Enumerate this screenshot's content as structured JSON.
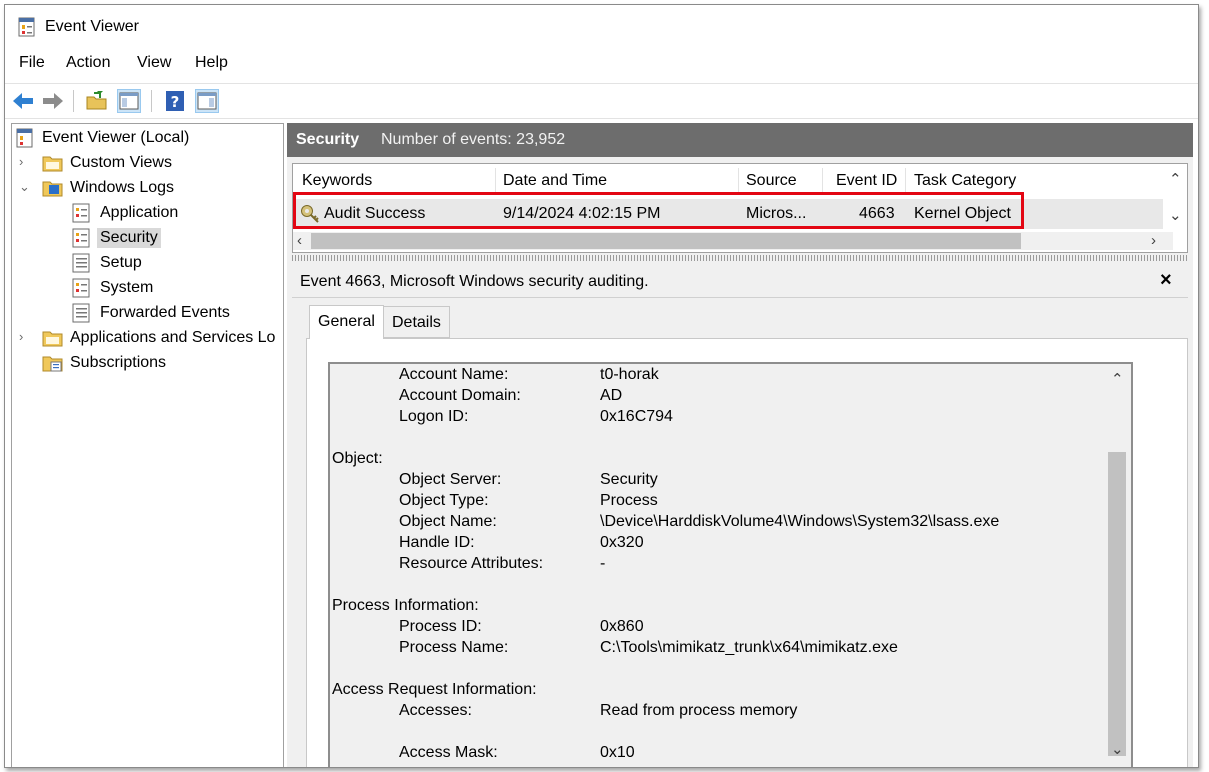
{
  "window": {
    "title": "Event Viewer"
  },
  "menu": [
    "File",
    "Action",
    "View",
    "Help"
  ],
  "toolbar": [
    "back-arrow-icon",
    "forward-arrow-icon",
    "open-folder-icon",
    "show-hide-console-tree-icon",
    "help-icon",
    "show-hide-action-pane-icon"
  ],
  "tree": {
    "root": "Event Viewer (Local)",
    "custom_views": "Custom Views",
    "windows_logs": "Windows Logs",
    "application": "Application",
    "security": "Security",
    "setup": "Setup",
    "system": "System",
    "forwarded_events": "Forwarded Events",
    "apps_services": "Applications and Services Lo",
    "subscriptions": "Subscriptions"
  },
  "log_header": {
    "name": "Security",
    "count_text": "Number of events: 23,952"
  },
  "grid": {
    "columns": [
      "Keywords",
      "Date and Time",
      "Source",
      "Event ID",
      "Task Category"
    ],
    "rows": [
      {
        "keywords": "Audit Success",
        "datetime": "9/14/2024 4:02:15 PM",
        "source": "Micros...",
        "event_id": "4663",
        "task_category": "Kernel Object"
      }
    ]
  },
  "detail": {
    "header": "Event 4663, Microsoft Windows security auditing.",
    "close": "×",
    "tabs": [
      "General",
      "Details"
    ],
    "active_tab": "General",
    "lines": [
      {
        "label": "Account Name:",
        "value": "t0-horak"
      },
      {
        "label": "Account Domain:",
        "value": "AD"
      },
      {
        "label": "Logon ID:",
        "value": "0x16C794"
      },
      {
        "section": "Object:"
      },
      {
        "label": "Object Server:",
        "value": "Security"
      },
      {
        "label": "Object Type:",
        "value": "Process"
      },
      {
        "label": "Object Name:",
        "value": "\\Device\\HarddiskVolume4\\Windows\\System32\\lsass.exe"
      },
      {
        "label": "Handle ID:",
        "value": "0x320"
      },
      {
        "label": "Resource Attributes:",
        "value": "-"
      },
      {
        "section": "Process Information:"
      },
      {
        "label": "Process ID:",
        "value": "0x860"
      },
      {
        "label": "Process Name:",
        "value": "C:\\Tools\\mimikatz_trunk\\x64\\mimikatz.exe"
      },
      {
        "section": "Access Request Information:"
      },
      {
        "label": "Accesses:",
        "value": "Read from process memory"
      },
      {
        "label": "Access Mask:",
        "value": "0x10"
      }
    ]
  },
  "colors": {
    "highlight": "#e30613",
    "log_header_bg": "#6d6d6d",
    "selected_row": "#e8e8e8"
  }
}
